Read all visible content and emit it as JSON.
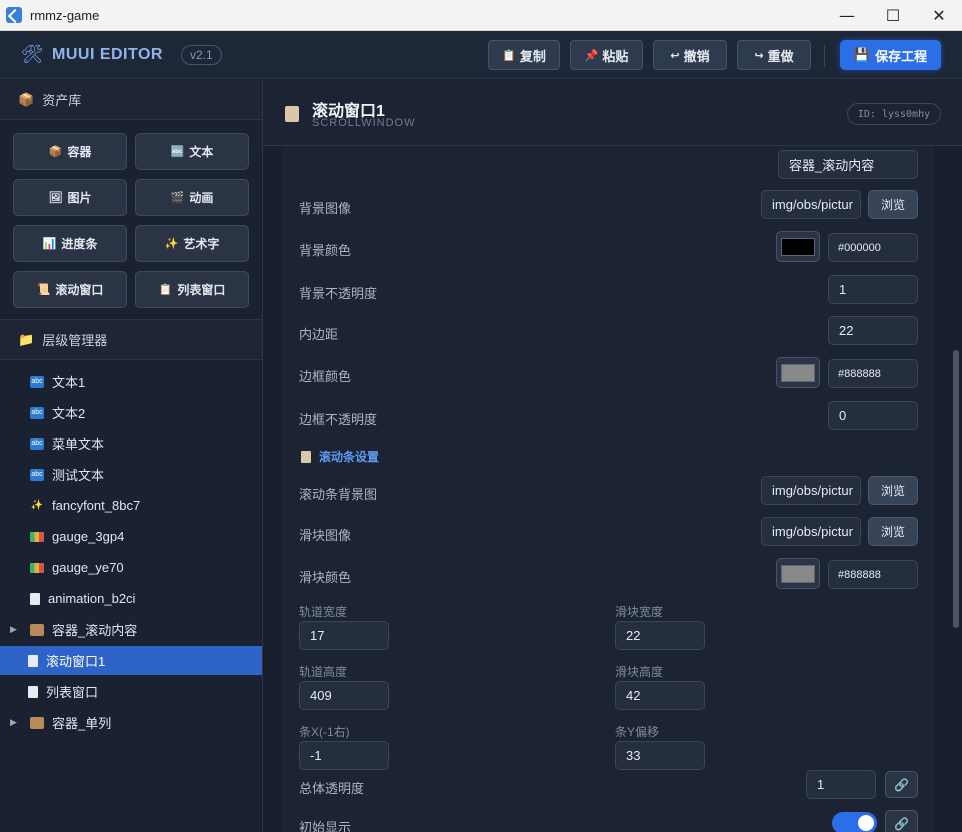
{
  "window": {
    "title": "rmmz-game",
    "minimize": "—",
    "maximize": "☐",
    "close": "✕"
  },
  "header": {
    "brand": "MUUI EDITOR",
    "version": "v2.1",
    "buttons": {
      "copy": "复制",
      "paste": "粘贴",
      "undo": "撤销",
      "redo": "重做",
      "save": "保存工程"
    }
  },
  "assets": {
    "title": "资产库",
    "items": [
      "容器",
      "文本",
      "图片",
      "动画",
      "进度条",
      "艺术字",
      "滚动窗口",
      "列表窗口"
    ]
  },
  "hierarchy": {
    "title": "层级管理器",
    "items": [
      "文本1",
      "文本2",
      "菜单文本",
      "测试文本",
      "fancyfont_8bc7",
      "gauge_3gp4",
      "gauge_ye70",
      "animation_b2ci",
      "容器_滚动内容",
      "滚动窗口1",
      "列表窗口",
      "容器_单列"
    ]
  },
  "panel": {
    "title": "滚动窗口1",
    "subtitle": "SCROLLWINDOW",
    "id": "ID: lyss0mhy"
  },
  "props": {
    "content_container": "容器_滚动内容",
    "bg_image_label": "背景图像",
    "bg_image_value": "img/obs/pictur",
    "browse": "浏览",
    "bg_color_label": "背景颜色",
    "bg_color_value": "#000000",
    "bg_opacity_label": "背景不透明度",
    "bg_opacity_value": "1",
    "padding_label": "内边距",
    "padding_value": "22",
    "border_color_label": "边框颜色",
    "border_color_value": "#888888",
    "border_opacity_label": "边框不透明度",
    "border_opacity_value": "0",
    "scroll_section": "滚动条设置",
    "scroll_bg_label": "滚动条背景图",
    "scroll_bg_value": "img/obs/pictur",
    "thumb_image_label": "滑块图像",
    "thumb_image_value": "img/obs/pictur",
    "thumb_color_label": "滑块颜色",
    "thumb_color_value": "#888888",
    "track_width_label": "轨道宽度",
    "track_width_value": "17",
    "thumb_width_label": "滑块宽度",
    "thumb_width_value": "22",
    "track_height_label": "轨道高度",
    "track_height_value": "409",
    "thumb_height_label": "滑块高度",
    "thumb_height_value": "42",
    "bar_x_label": "条X(-1右)",
    "bar_x_value": "-1",
    "bar_y_label": "条Y偏移",
    "bar_y_value": "33",
    "overall_opacity_label": "总体透明度",
    "overall_opacity_value": "1",
    "initial_visible_label": "初始显示"
  },
  "colors": {
    "bg_swatch": "#000000",
    "border_swatch": "#888888",
    "thumb_swatch": "#888888",
    "accent": "#2b6ee8"
  }
}
